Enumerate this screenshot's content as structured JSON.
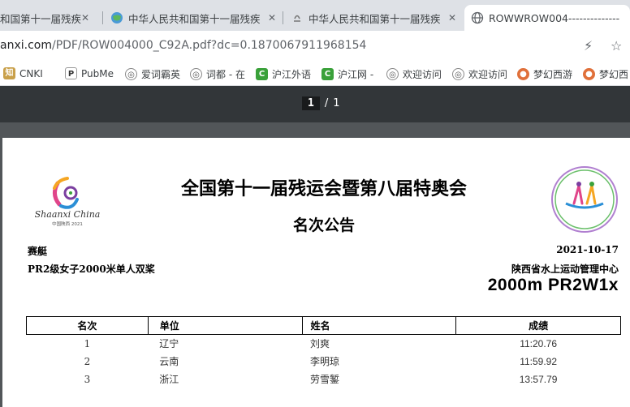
{
  "browser": {
    "tabs": [
      {
        "title": "和国第十一届残疾",
        "active": false
      },
      {
        "title": "中华人民共和国第十一届残疾",
        "active": false
      },
      {
        "title": "中华人民共和国第十一届残疾",
        "active": false
      },
      {
        "title": "ROWWROW004--------------",
        "active": true
      }
    ],
    "url_host": "anxi.com",
    "url_path": "/PDF/ROW004000_C92A.pdf?dc=0.1870067911968154",
    "bookmarks": [
      "CNKI",
      "PubMe",
      "爱词霸英",
      "词都 - 在",
      "沪江外语",
      "沪江网 -",
      "欢迎访问",
      "欢迎访问",
      "梦幻西游",
      "梦幻西"
    ]
  },
  "pdf": {
    "current_page": "1",
    "separator": "/",
    "total_pages": "1"
  },
  "document": {
    "title": "全国第十一届残运会暨第八届特奥会",
    "subtitle": "名次公告",
    "sport": "赛艇",
    "date": "2021-10-17",
    "event": "PR2级女子2000米单人双桨",
    "organizer": "陕西省水上运动管理中心",
    "event_code": "2000m PR2W1x",
    "logo_text": "Shaanxi China",
    "logo_subtext": "中国陕西 2021",
    "headers": {
      "rank": "名次",
      "unit": "单位",
      "name": "姓名",
      "result": "成绩"
    },
    "rows": [
      {
        "rank": "1",
        "unit": "辽宁",
        "name": "刘爽",
        "result": "11:20.76"
      },
      {
        "rank": "2",
        "unit": "云南",
        "name": "李明琼",
        "result": "11:59.92"
      },
      {
        "rank": "3",
        "unit": "浙江",
        "name": "劳雪錾",
        "result": "13:57.79"
      }
    ]
  }
}
